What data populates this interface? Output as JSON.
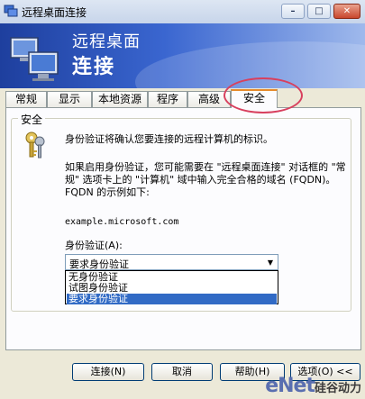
{
  "window": {
    "title": "远程桌面连接"
  },
  "banner": {
    "line1": "远程桌面",
    "line2": "连接"
  },
  "tabs": [
    {
      "label": "常规"
    },
    {
      "label": "显示"
    },
    {
      "label": "本地资源"
    },
    {
      "label": "程序"
    },
    {
      "label": "高级"
    },
    {
      "label": "安全"
    }
  ],
  "security": {
    "group_title": "安全",
    "description": "身份验证将确认您要连接的远程计算机的标识。",
    "paragraph": "如果启用身份验证，您可能需要在 \"远程桌面连接\" 对话框的 \"常规\" 选项卡上的 \"计算机\" 域中输入完全合格的域名 (FQDN)。FQDN 的示例如下:",
    "example": "example.microsoft.com",
    "auth_label": "身份验证(A):",
    "auth_selected": "要求身份验证",
    "auth_options": [
      "无身份验证",
      "试图身份验证",
      "要求身份验证"
    ]
  },
  "buttons": {
    "connect": "连接(N)",
    "cancel": "取消",
    "help": "帮助(H)",
    "options": "选项(O) <<"
  },
  "watermark": {
    "brand": "eNet",
    "cn": "硅谷动力"
  },
  "colors": {
    "banner_start": "#1e3f9e",
    "selection": "#316ac5",
    "active_tab_accent": "#e68b2c",
    "annotation": "#d8405e"
  }
}
